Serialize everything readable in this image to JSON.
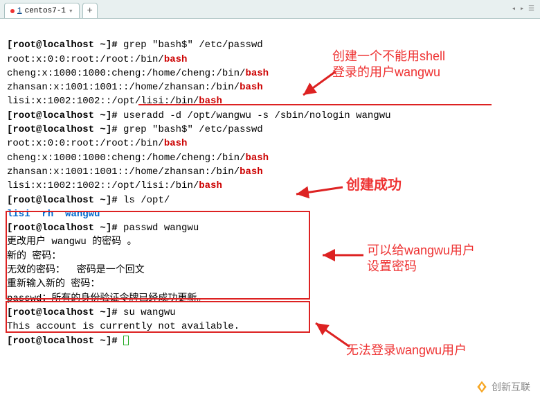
{
  "tabbar": {
    "tab_number": "1",
    "tab_label": "centos7-1",
    "add_label": "+"
  },
  "term": {
    "prompt": "[root@localhost ~]#",
    "cmd_grep1": "grep \"bash$\" /etc/passwd",
    "line_root": "root:x:0:0:root:/root:/bin/",
    "bash": "bash",
    "line_cheng": "cheng:x:1000:1000:cheng:/home/cheng:/bin/",
    "line_zhansan": "zhansan:x:1001:1001::/home/zhansan:/bin/",
    "line_lisi": "lisi:x:1002:1002::/opt/lisi:/bin/",
    "cmd_useradd": "useradd -d /opt/wangwu -s /sbin/nologin wangwu",
    "cmd_grep2": "grep \"bash$\" /etc/passwd",
    "cmd_ls": "ls /opt/",
    "ls_lisi": "lisi",
    "ls_rh": "rh",
    "ls_wangwu": "wangwu",
    "cmd_passwd": "passwd wangwu",
    "pw_line1": "更改用户 wangwu 的密码 。",
    "pw_line2": "新的 密码：",
    "pw_line3": "无效的密码：  密码是一个回文",
    "pw_line4": "重新输入新的 密码：",
    "pw_line5": "passwd：所有的身份验证令牌已经成功更新。",
    "cmd_su": "su wangwu",
    "su_msg": "This account is currently not available."
  },
  "annotations": {
    "a1_l1": "创建一个不能用shell",
    "a1_l2": "登录的用户wangwu",
    "a2": "创建成功",
    "a3_l1": "可以给wangwu用户",
    "a3_l2": "设置密码",
    "a4": "无法登录wangwu用户"
  },
  "footer": {
    "brand": "创新互联"
  }
}
